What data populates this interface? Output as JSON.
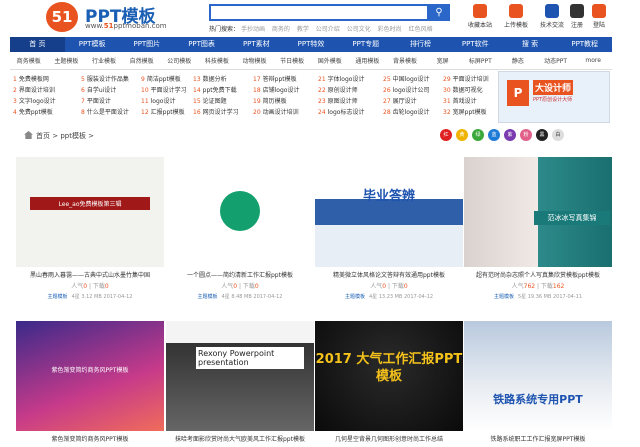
{
  "header": {
    "logo_mark": "51",
    "logo_title": "PPT模板",
    "logo_url_pre": "www.",
    "logo_url_mid": "51",
    "logo_url_post": "pptmoban.com",
    "search_placeholder": "",
    "hot_label": "热门搜索：",
    "hot_tags": [
      "手抄动画",
      "商务的",
      "教学",
      "公司介绍",
      "公司文化",
      "彩色时尚",
      "红色风格"
    ],
    "quick": [
      {
        "label": "收藏本站",
        "color": "#e8531f"
      },
      {
        "label": "上传模板",
        "color": "#e8531f"
      },
      {
        "label": "技术交流",
        "color": "#1e54b0"
      },
      {
        "label": "注册",
        "color": "#333"
      },
      {
        "label": "登陆",
        "color": "#e8531f"
      }
    ]
  },
  "nav": [
    "首 页",
    "PPT模板",
    "PPT图片",
    "PPT图表",
    "PPT素材",
    "PPT特效",
    "PPT专题",
    "排行榜",
    "PPT软件",
    "搜 索",
    "PPT教程"
  ],
  "subnav": [
    "商务模板",
    "主题模板",
    "行业模板",
    "自然模板",
    "公司模板",
    "科技模板",
    "动物模板",
    "节日模板",
    "国外模板",
    "通用模板",
    "背景模板",
    "宽屏",
    "标屏PPT",
    "静态",
    "动态PPT",
    "more"
  ],
  "links": [
    [
      "1 免费模板网",
      "2 界面设计培训",
      "3 文字logo设计",
      "4 免费ppt模板"
    ],
    [
      "5 服装设计作品集",
      "6 自学ui设计",
      "7 平面设计",
      "8 什么是平面设计"
    ],
    [
      "9 简洁ppt模板",
      "10 平面设计学习",
      "11 logo设计",
      "12 汇报ppt模板"
    ],
    [
      "13 数据分析",
      "14 ppt免费下载",
      "15 论证图题",
      "16 网页设计学习"
    ],
    [
      "17 答辩ppt模板",
      "18 店铺logo设计",
      "19 简历模板",
      "20 动画设计培训"
    ],
    [
      "21 字体logo设计",
      "22 原创设计师",
      "23 原图设计师",
      "24 logo标志设计"
    ],
    [
      "25 中国logo设计",
      "26 logo设计公司",
      "27 展厅设计",
      "28 齿轮logo设计"
    ],
    [
      "29 平面设计培训",
      "30 数据可视化",
      "31 首戏设计",
      "32 宽屏ppt模板"
    ]
  ],
  "ad": {
    "title": "大设计师",
    "sub": "PPT原创设计大师"
  },
  "breadcrumb": "首页 > ppt模板 >",
  "colors": [
    {
      "label": "红",
      "color": "#e02020"
    },
    {
      "label": "黄",
      "color": "#f0b400"
    },
    {
      "label": "绿",
      "color": "#3aa83a"
    },
    {
      "label": "蓝",
      "color": "#1e7ad6"
    },
    {
      "label": "紫",
      "color": "#7a3ab0"
    },
    {
      "label": "粉",
      "color": "#e0608a"
    },
    {
      "label": "黑",
      "color": "#222222"
    },
    {
      "label": "白",
      "color": "#dddddd"
    }
  ],
  "cards": [
    {
      "title": "黑山春雨入暮霭——古典中式山水墨竹集中国",
      "likes": "0",
      "downloads": "0",
      "meta": "主题模板  4星 3.12 MB 2017-04-12",
      "thumb_text": "Lee_ao免费模板第三辑"
    },
    {
      "title": "一个圆点——简约清新工作汇报ppt模板",
      "likes": "0",
      "downloads": "0",
      "meta": "主题模板  4星 8.48 MB 2017-04-12",
      "thumb_text": ""
    },
    {
      "title": "精美微立体风格论文答辩有效通用ppt模板",
      "likes": "0",
      "downloads": "0",
      "meta": "主题模板  4星 13.23 MB 2017-04-12",
      "thumb_text": "毕业答辨"
    },
    {
      "title": "超有范时尚杂志照个人写真集欣赏模板ppt模板",
      "likes": "762",
      "downloads": "162",
      "meta": "主题模板  5星 19.36 MB 2017-04-11",
      "thumb_text": "范冰冰写真集锦"
    },
    {
      "title": "紫色渐变简约商务风PPT模板",
      "likes": "",
      "downloads": "",
      "meta": "",
      "thumb_text": "紫色渐变简约商务风PPT模板"
    },
    {
      "title": "抹哈考面影欣赏时尚大气欧美风工作汇报ppt模板",
      "likes": "",
      "downloads": "",
      "meta": "",
      "thumb_text": "Rexony Powerpoint presentation"
    },
    {
      "title": "几何星空背景几何图形创意时尚工作总结",
      "likes": "",
      "downloads": "",
      "meta": "",
      "thumb_text": "2017 大气工作汇报PPT模板"
    },
    {
      "title": "铁路系统职工工作汇报宽屏PPT模板",
      "likes": "",
      "downloads": "",
      "meta": "",
      "thumb_text": "铁路系统专用PPT"
    }
  ],
  "labels": {
    "likes": "人气",
    "downloads": "下载"
  }
}
